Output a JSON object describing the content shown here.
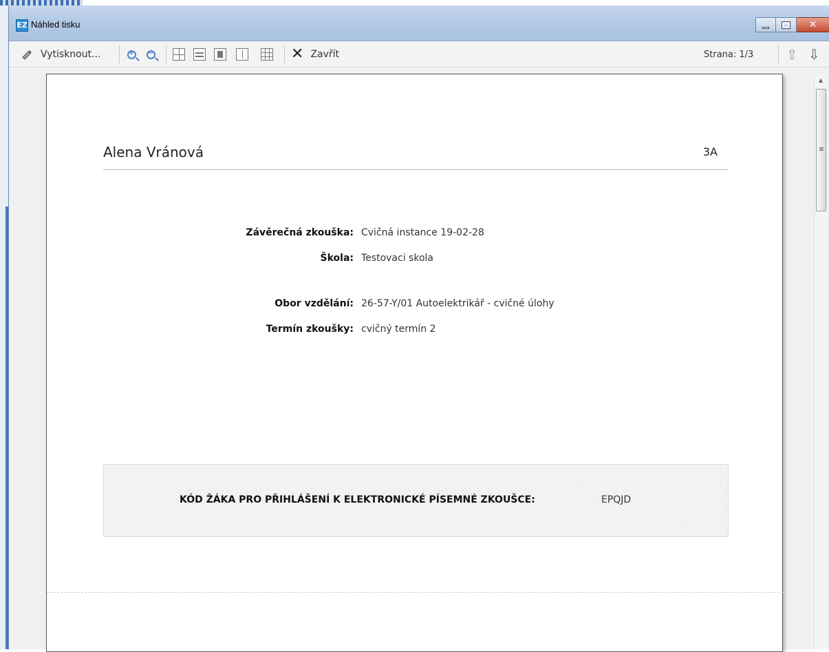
{
  "window": {
    "title": "Náhled tisku",
    "app_icon": "EZ"
  },
  "toolbar": {
    "print_label": "Vytisknout...",
    "close_label": "Zavřít",
    "page_indicator": "Strana: 1/3"
  },
  "document": {
    "student_name": "Alena  Vránová",
    "student_class": "3A",
    "fields": [
      {
        "label": "Závěrečná zkouška:",
        "value": "Cvičná instance 19-02-28"
      },
      {
        "label": "Škola:",
        "value": "Testovaci skola"
      },
      {
        "label": "Obor vzdělání:",
        "value": "26-57-Y/01 Autoelektrikář - cvičné úlohy"
      },
      {
        "label": "Termín zkoušky:",
        "value": "cvičný termín 2"
      }
    ],
    "code_label": "KÓD ŽÁKA PRO PŘIHLÁŠENÍ K ELEKTRONICKÉ PÍSEMNÉ ZKOUŠCE:",
    "code_value": "EPQJD"
  },
  "colors": {
    "titlebar": "#b4cbe6",
    "toolbar_bg": "#f3f3f3",
    "close_button": "#c44a32",
    "page_bg": "#ffffff",
    "code_box_bg": "#ededed"
  }
}
